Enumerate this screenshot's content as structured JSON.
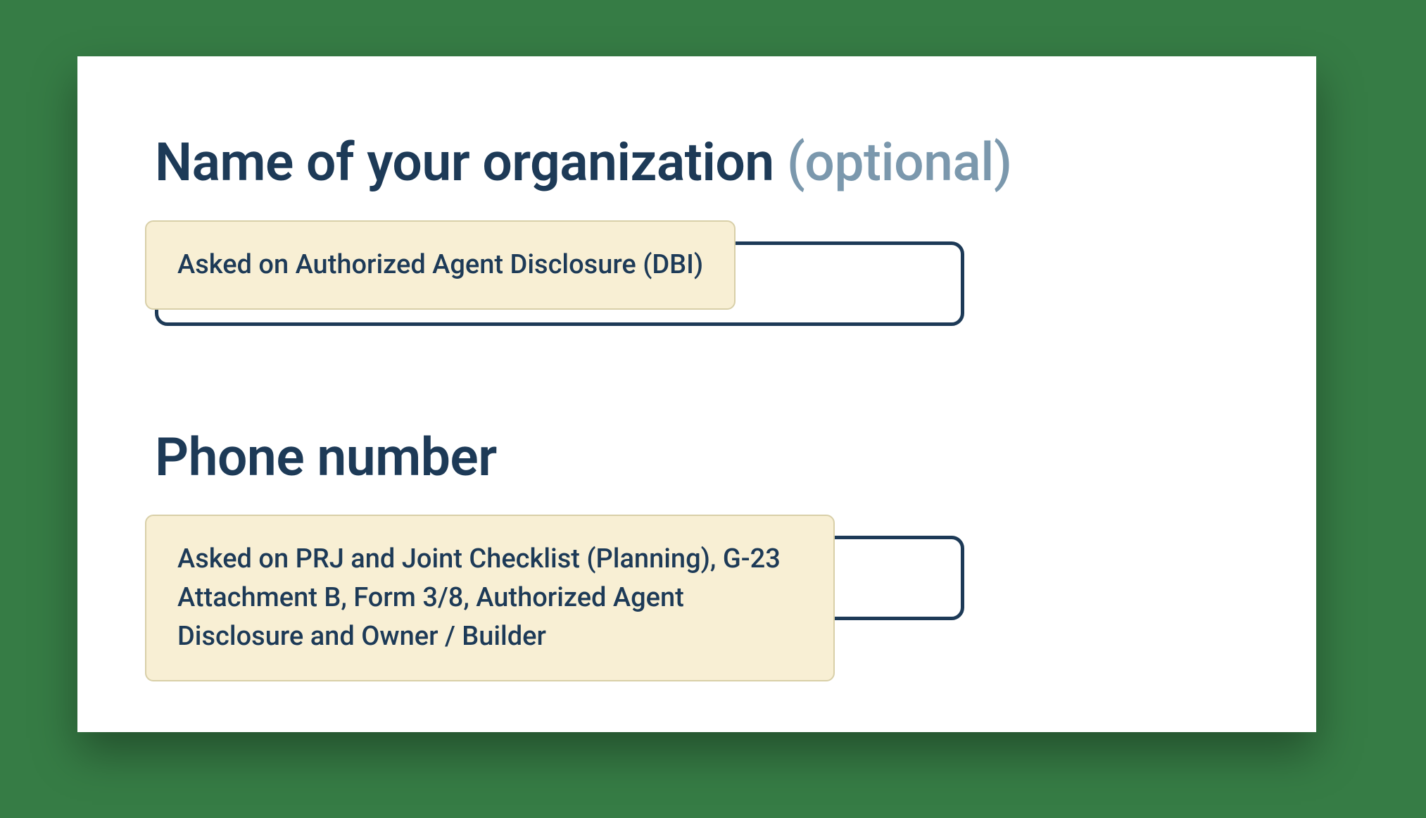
{
  "fields": {
    "org": {
      "label": "Name of your organization",
      "optional_suffix": "(optional)",
      "tooltip": "Asked on Authorized Agent Disclosure (DBI)",
      "value": ""
    },
    "phone": {
      "label": "Phone number",
      "tooltip": "Asked on PRJ and Joint Checklist (Planning), G-23 Attachment B, Form 3/8, Authorized Agent Disclosure and Owner / Builder",
      "value": ""
    }
  }
}
